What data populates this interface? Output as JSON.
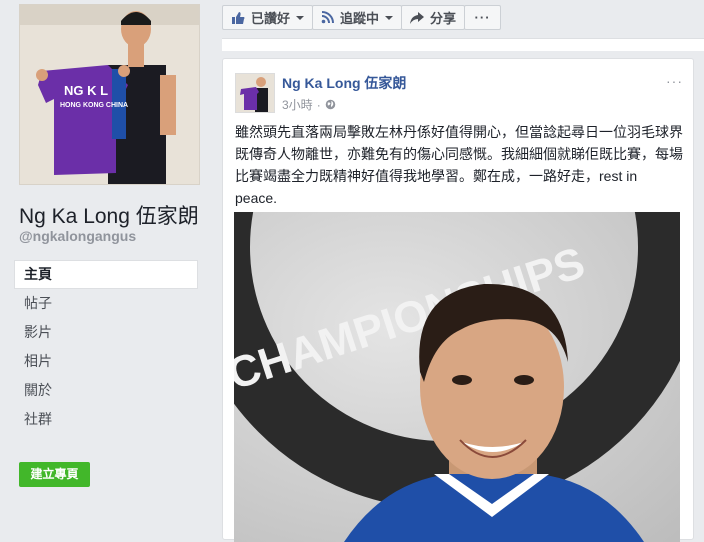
{
  "page": {
    "name": "Ng Ka Long 伍家朗",
    "handle": "@ngkalongangus",
    "photo_shirt_text": [
      "NG K L",
      "HONG KONG CHINA"
    ]
  },
  "nav": {
    "items": [
      {
        "label": "主頁",
        "active": true
      },
      {
        "label": "帖子",
        "active": false
      },
      {
        "label": "影片",
        "active": false
      },
      {
        "label": "相片",
        "active": false
      },
      {
        "label": "關於",
        "active": false
      },
      {
        "label": "社群",
        "active": false
      }
    ],
    "create_page_label": "建立專頁"
  },
  "actions": {
    "liked_label": "已讚好",
    "following_label": "追蹤中",
    "share_label": "分享",
    "more_label": "···"
  },
  "post": {
    "author": "Ng Ka Long 伍家朗",
    "time": "3小時",
    "options_label": "···",
    "text": "雖然頭先直落兩局擊敗左林丹係好值得開心，但當諗起尋日一位羽毛球界既傳奇人物離世，亦難免有的傷心同感慨。我細細個就睇佢既比賽，每場比賽竭盡全力既精神好值得我地學習。鄭在成，一路好走，rest in peace.",
    "image_banner_text": "CHAMPIONSHIPS"
  },
  "colors": {
    "link_blue": "#365899",
    "fb_green": "#42b72a",
    "page_bg": "#e9ebee",
    "jersey_purple": "#6b2fa8",
    "jersey_blue": "#1f4fa8"
  }
}
